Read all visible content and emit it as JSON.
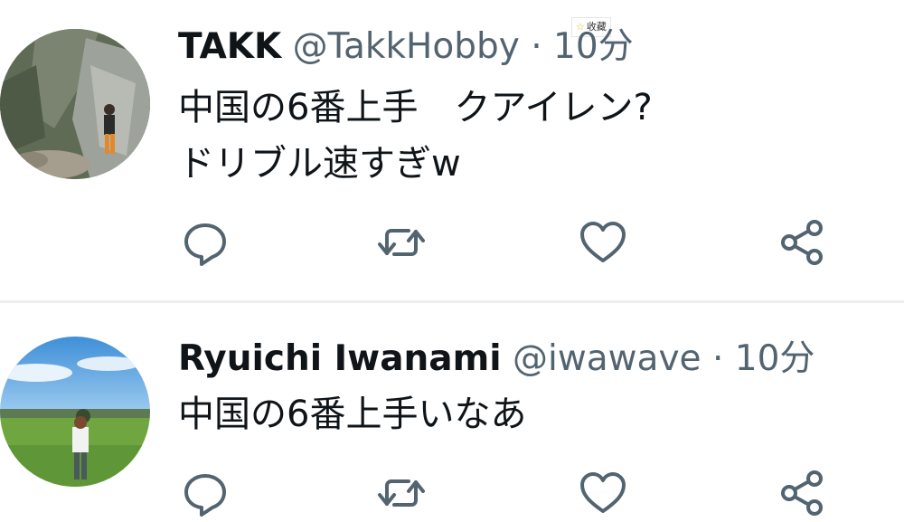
{
  "collect_badge": {
    "star": "☆",
    "label": "收藏"
  },
  "tweets": [
    {
      "name": "TAKK",
      "handle": "@TakkHobby",
      "separator": "·",
      "time": "10分",
      "lines": [
        "中国の6番上手　クアイレン?",
        "ドリブル速すぎw"
      ],
      "avatar_scene": "hiker-on-cliff"
    },
    {
      "name": "Ryuichi Iwanami",
      "handle": "@iwawave",
      "separator": "·",
      "time": "10分",
      "lines": [
        "中国の6番上手いなあ"
      ],
      "avatar_scene": "person-on-grass-field"
    }
  ],
  "actions": [
    {
      "name": "reply",
      "icon": "reply-icon"
    },
    {
      "name": "retweet",
      "icon": "retweet-icon"
    },
    {
      "name": "like",
      "icon": "heart-icon"
    },
    {
      "name": "share",
      "icon": "share-icon"
    }
  ],
  "colors": {
    "text": "#0f1419",
    "secondary": "#536471",
    "divider": "#eceef0"
  }
}
